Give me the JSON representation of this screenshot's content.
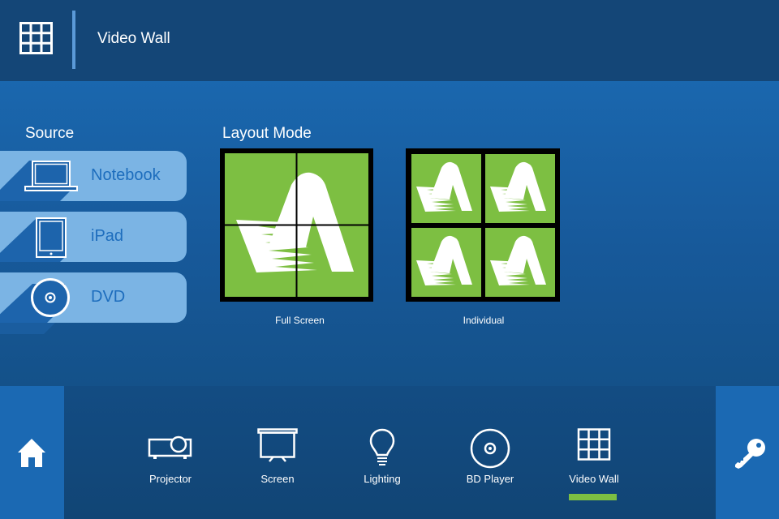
{
  "header": {
    "menu_icon": "grid-icon",
    "title": "Video Wall"
  },
  "source": {
    "label": "Source",
    "items": [
      {
        "label": "Notebook",
        "icon": "laptop-icon"
      },
      {
        "label": "iPad",
        "icon": "tablet-icon"
      },
      {
        "label": "DVD",
        "icon": "disc-icon"
      }
    ]
  },
  "layout": {
    "label": "Layout Mode",
    "modes": [
      {
        "label": "Full Screen",
        "icon": "full-screen-layout-icon"
      },
      {
        "label": "Individual",
        "icon": "individual-layout-icon"
      }
    ]
  },
  "footer": {
    "home_icon": "home-icon",
    "key_icon": "key-icon",
    "nav": [
      {
        "label": "Projector",
        "icon": "projector-icon"
      },
      {
        "label": "Screen",
        "icon": "projection-screen-icon"
      },
      {
        "label": "Lighting",
        "icon": "light-bulb-icon"
      },
      {
        "label": "BD Player",
        "icon": "disc-icon"
      },
      {
        "label": "Video Wall",
        "icon": "grid-icon",
        "active": true
      }
    ]
  },
  "colors": {
    "accent_green": "#7dbf42",
    "header_bg": "#144677",
    "button_light_blue": "#7bb4e4",
    "button_text_blue": "#1d6dbd",
    "side_button_blue": "#1b69b3"
  }
}
